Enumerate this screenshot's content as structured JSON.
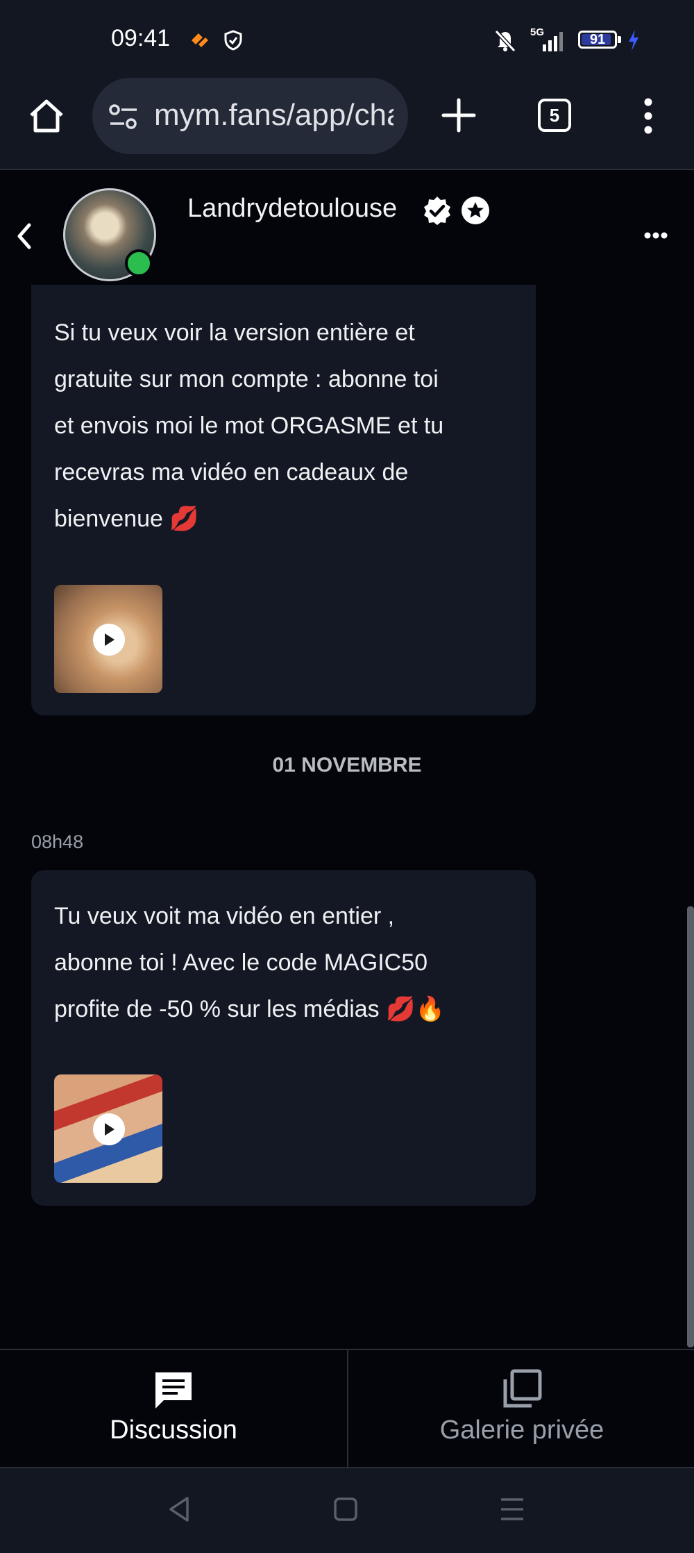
{
  "status_bar": {
    "time": "09:41",
    "network_label": "5G",
    "battery_level": "91",
    "battery_fraction": 0.91
  },
  "browser": {
    "url": "mym.fans/app/chat",
    "tab_count": "5"
  },
  "chat": {
    "username": "Landrydetoulouse",
    "status": "Online"
  },
  "messages": [
    {
      "text_lines": [
        "Si tu veux voir la version entière et",
        "gratuite sur mon compte : abonne toi",
        "et envois moi le mot ORGASME et tu",
        "recevras ma vidéo en cadeaux de",
        "bienvenue 💋"
      ]
    },
    {
      "time": "08h48",
      "text_lines": [
        "Tu veux voit ma vidéo en entier ,",
        "abonne toi ! Avec le code MAGIC50",
        "profite de -50 % sur les médias 💋🔥"
      ]
    }
  ],
  "date_separator": "01 NOVEMBRE",
  "bottom_tabs": [
    {
      "label": "Discussion",
      "icon": "chat-icon",
      "active": true
    },
    {
      "label": "Galerie privée",
      "icon": "gallery-icon",
      "active": false
    }
  ],
  "colors": {
    "background": "#03050b",
    "bubble": "#141824",
    "online": "#2bbd4e",
    "inactive_text": "#9aa0aa"
  }
}
